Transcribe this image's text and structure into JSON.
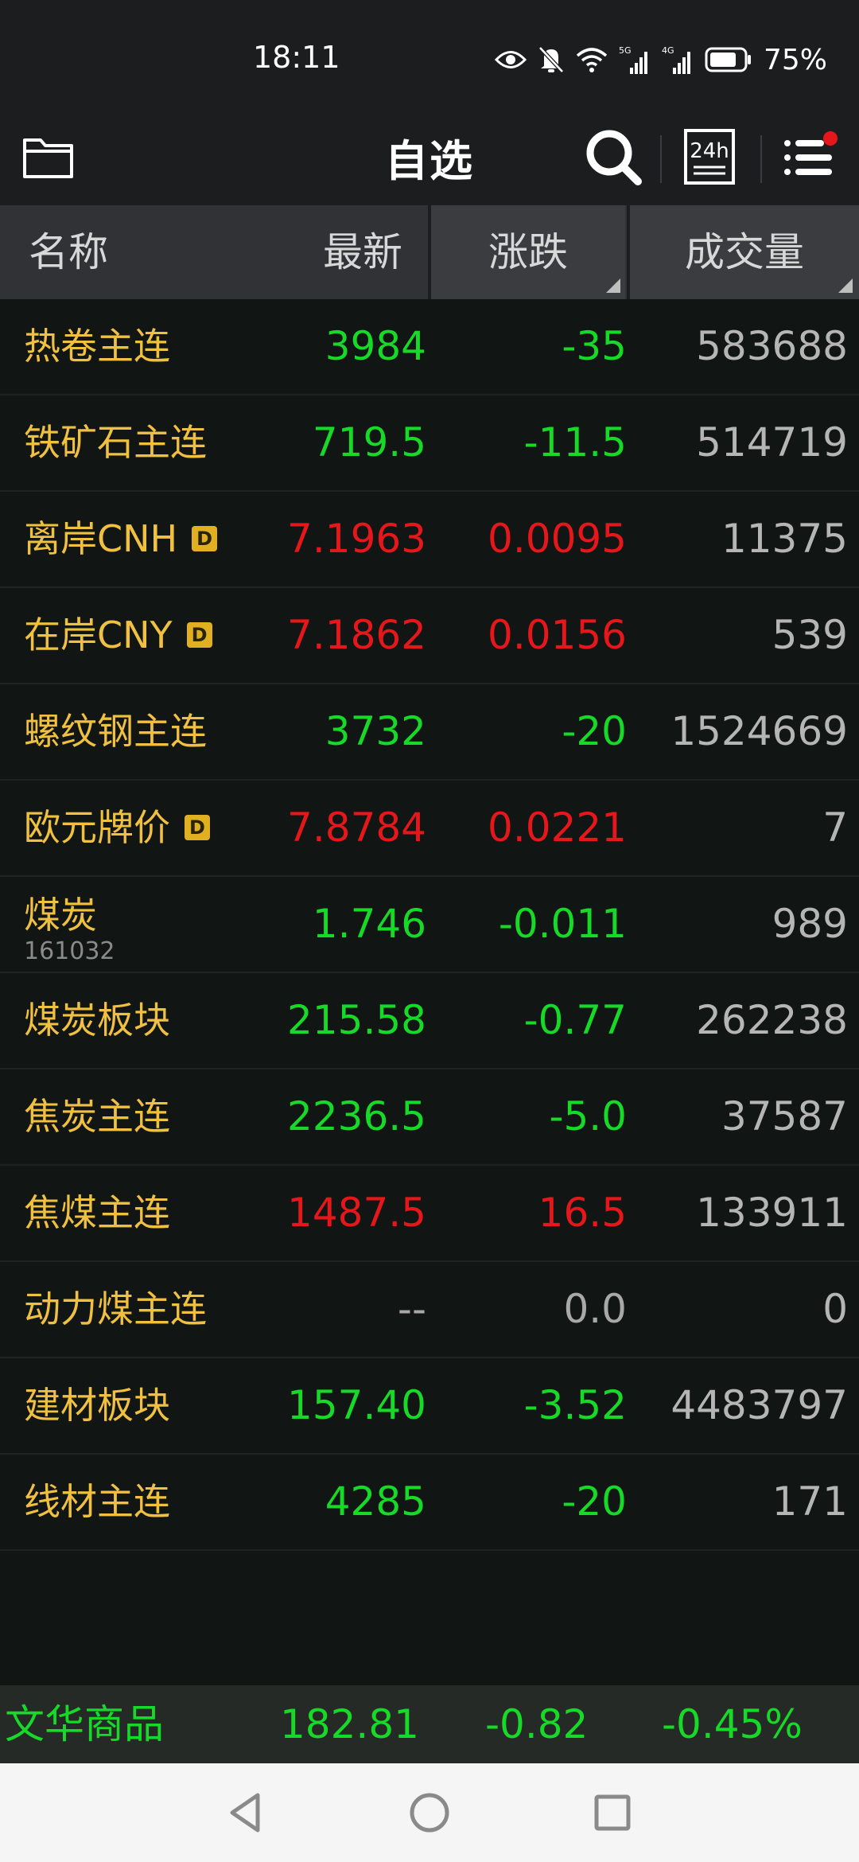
{
  "status_bar": {
    "time": "18:11",
    "signal_1_label": "5G",
    "signal_2_label": "4G",
    "battery_percent": "75%"
  },
  "header": {
    "title": "自选",
    "icons": [
      "folder-icon",
      "search-icon",
      "24h-icon",
      "menu-icon"
    ],
    "h24_label": "24h",
    "notification_dot_color": "#e5171b"
  },
  "columns": {
    "name": "名称",
    "latest": "最新",
    "change": "涨跌",
    "volume": "成交量"
  },
  "rows": [
    {
      "name": "热卷主连",
      "badge": "",
      "code": "",
      "latest": "3984",
      "change": "-35",
      "volume": "583688",
      "trend": "down"
    },
    {
      "name": "铁矿石主连",
      "badge": "",
      "code": "",
      "latest": "719.5",
      "change": "-11.5",
      "volume": "514719",
      "trend": "down"
    },
    {
      "name": "离岸CNH",
      "badge": "D",
      "code": "",
      "latest": "7.1963",
      "change": "0.0095",
      "volume": "11375",
      "trend": "up"
    },
    {
      "name": "在岸CNY",
      "badge": "D",
      "code": "",
      "latest": "7.1862",
      "change": "0.0156",
      "volume": "539",
      "trend": "up"
    },
    {
      "name": "螺纹钢主连",
      "badge": "",
      "code": "",
      "latest": "3732",
      "change": "-20",
      "volume": "1524669",
      "trend": "down"
    },
    {
      "name": "欧元牌价",
      "badge": "D",
      "code": "",
      "latest": "7.8784",
      "change": "0.0221",
      "volume": "7",
      "trend": "up"
    },
    {
      "name": "煤炭",
      "badge": "",
      "code": "161032",
      "latest": "1.746",
      "change": "-0.011",
      "volume": "989",
      "trend": "down"
    },
    {
      "name": "煤炭板块",
      "badge": "",
      "code": "",
      "latest": "215.58",
      "change": "-0.77",
      "volume": "262238",
      "trend": "down"
    },
    {
      "name": "焦炭主连",
      "badge": "",
      "code": "",
      "latest": "2236.5",
      "change": "-5.0",
      "volume": "37587",
      "trend": "down"
    },
    {
      "name": "焦煤主连",
      "badge": "",
      "code": "",
      "latest": "1487.5",
      "change": "16.5",
      "volume": "133911",
      "trend": "up"
    },
    {
      "name": "动力煤主连",
      "badge": "",
      "code": "",
      "latest": "--",
      "change": "0.0",
      "volume": "0",
      "trend": "flat"
    },
    {
      "name": "建材板块",
      "badge": "",
      "code": "",
      "latest": "157.40",
      "change": "-3.52",
      "volume": "4483797",
      "trend": "down"
    },
    {
      "name": "线材主连",
      "badge": "",
      "code": "",
      "latest": "4285",
      "change": "-20",
      "volume": "171",
      "trend": "down"
    }
  ],
  "index_bar": {
    "name": "文华商品",
    "value": "182.81",
    "change": "-0.82",
    "percent": "-0.45%"
  },
  "colors": {
    "up": "#e5171b",
    "down": "#17d927",
    "flat": "#a8a8a8",
    "name": "#f0c040"
  },
  "nav_bar": {
    "icons": [
      "back-icon",
      "home-icon",
      "recents-icon"
    ]
  }
}
